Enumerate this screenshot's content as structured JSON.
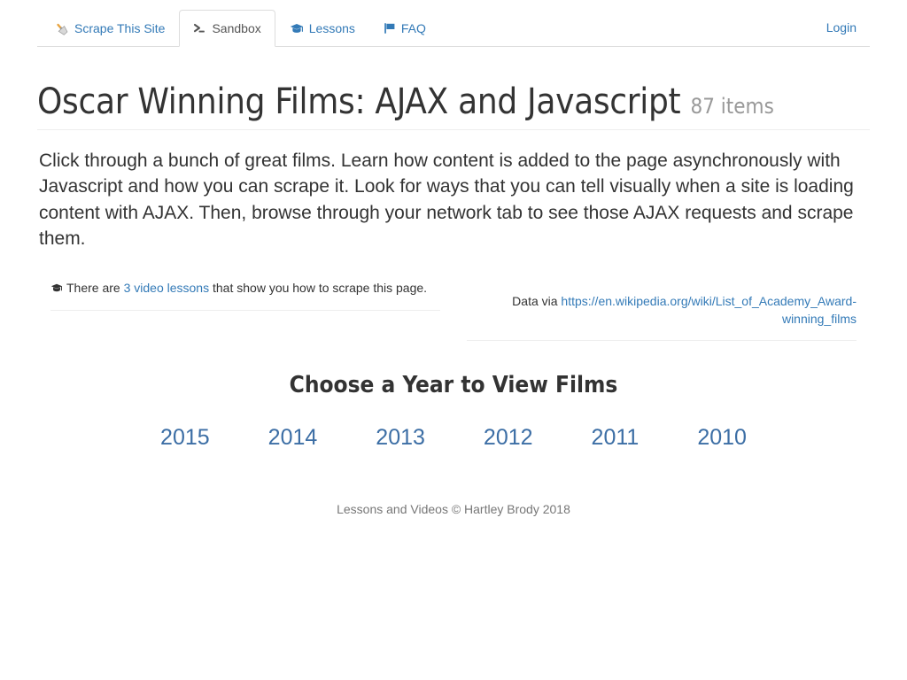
{
  "navbar": {
    "brand": {
      "label": "Scrape This Site",
      "icon": "paint-scraper-icon"
    },
    "tabs": [
      {
        "id": "sandbox",
        "label": "Sandbox",
        "icon": "terminal-prompt-icon",
        "active": true
      },
      {
        "id": "lessons",
        "label": "Lessons",
        "icon": "graduation-cap-icon",
        "active": false
      },
      {
        "id": "faq",
        "label": "FAQ",
        "icon": "flag-icon",
        "active": false
      }
    ],
    "login_label": "Login"
  },
  "header": {
    "title": "Oscar Winning Films: AJAX and Javascript",
    "badge": "87 items"
  },
  "lead": "Click through a bunch of great films. Learn how content is added to the page asynchronously with Javascript and how you can scrape it. Look for ways that you can tell visually when a site is loading content with AJAX. Then, browse through your network tab to see those AJAX requests and scrape them.",
  "info": {
    "lessons": {
      "icon": "graduation-cap-icon",
      "prefix": "There are ",
      "link_label": "3 video lessons",
      "suffix": " that show you how to scrape this page."
    },
    "source": {
      "prefix": "Data via ",
      "link_label": "https://en.wikipedia.org/wiki/List_of_Academy_Award-winning_films"
    }
  },
  "years": {
    "heading": "Choose a Year to View Films",
    "items": [
      {
        "label": "2015"
      },
      {
        "label": "2014"
      },
      {
        "label": "2013"
      },
      {
        "label": "2012"
      },
      {
        "label": "2011"
      },
      {
        "label": "2010"
      }
    ]
  },
  "footer": {
    "text": "Lessons and Videos © Hartley Brody 2018"
  },
  "colors": {
    "link": "#337ab7",
    "year_link": "#3c6ea5",
    "text": "#333333",
    "muted": "#999999",
    "footer_text": "#777777",
    "border": "#dddddd",
    "border_light": "#eeeeee",
    "active_tab_text": "#555555"
  }
}
